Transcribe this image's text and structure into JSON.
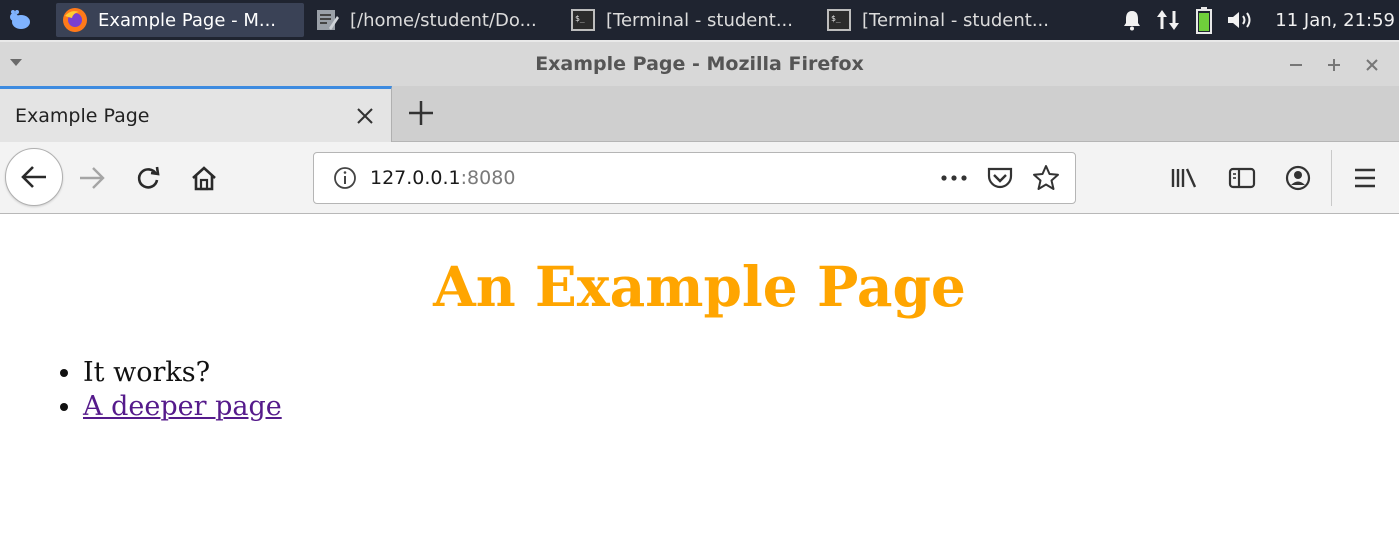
{
  "panel": {
    "tasks": [
      {
        "label": "Example Page - M...",
        "icon": "firefox-icon",
        "active": true
      },
      {
        "label": "[/home/student/Do...",
        "icon": "text-editor-icon",
        "active": false
      },
      {
        "label": "[Terminal - student...",
        "icon": "terminal-icon",
        "active": false
      },
      {
        "label": "[Terminal - student...",
        "icon": "terminal-icon",
        "active": false
      }
    ],
    "tray_icons": [
      "bell-icon",
      "network-icon",
      "battery-icon",
      "volume-icon"
    ],
    "clock": "11 Jan, 21:59"
  },
  "window": {
    "title": "Example Page - Mozilla Firefox"
  },
  "tabs": [
    {
      "label": "Example Page",
      "active": true
    }
  ],
  "navbar": {
    "url_host": "127.0.0.1",
    "url_port": ":8080"
  },
  "page": {
    "heading": "An Example Page",
    "heading_color": "#ffa500",
    "items": [
      {
        "text": "It works?",
        "link": false
      },
      {
        "text": "A deeper page",
        "link": true
      }
    ],
    "link_color": "#551a8b"
  }
}
